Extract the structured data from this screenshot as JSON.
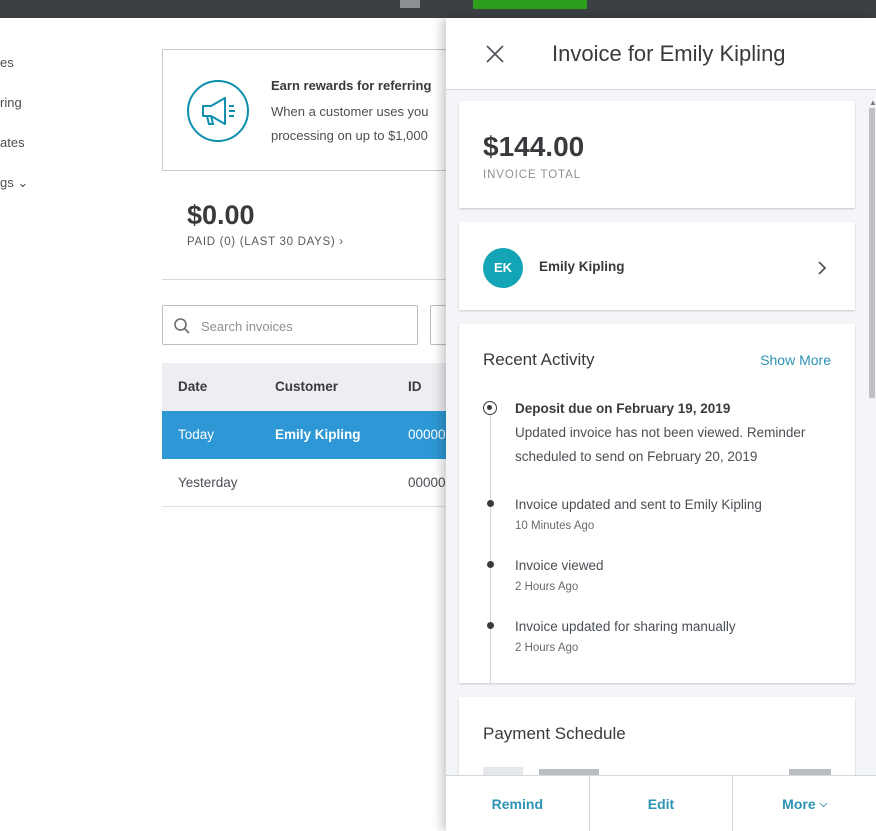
{
  "topbar": {
    "accent": "#2ca01c"
  },
  "left_nav": {
    "items": [
      "es",
      "ring",
      "ates",
      "gs ⌄"
    ]
  },
  "promo": {
    "icon": "megaphone-icon",
    "title": "Earn rewards for referring",
    "line1": "When a customer uses you",
    "line2": "processing on up to $1,000"
  },
  "summary": {
    "amount": "$0.00",
    "label": "PAID (0) (LAST 30 DAYS) ›"
  },
  "search": {
    "placeholder": "Search invoices"
  },
  "table": {
    "columns": [
      "Date",
      "Customer",
      "ID"
    ],
    "rows": [
      {
        "date": "Today",
        "customer": "Emily Kipling",
        "id": "00000",
        "selected": true
      },
      {
        "date": "Yesterday",
        "customer": "",
        "id": "00000",
        "selected": false
      }
    ]
  },
  "panel": {
    "title": "Invoice for Emily Kipling",
    "total": {
      "amount": "$144.00",
      "label": "INVOICE TOTAL"
    },
    "customer": {
      "initials": "EK",
      "name": "Emily Kipling",
      "avatar_color": "#13a5b5"
    },
    "activity": {
      "title": "Recent Activity",
      "show_more": "Show More",
      "items": [
        {
          "text": "Deposit due on February 19, 2019",
          "detail1": "Updated invoice has not been viewed. Reminder",
          "detail2": "scheduled to send on February 20, 2019"
        },
        {
          "text": "Invoice updated and sent to Emily Kipling",
          "time": "10 Minutes Ago"
        },
        {
          "text": "Invoice viewed",
          "time": "2 Hours Ago"
        },
        {
          "text": "Invoice updated for sharing manually",
          "time": "2 Hours Ago"
        }
      ]
    },
    "schedule": {
      "title": "Payment Schedule"
    },
    "footer": {
      "remind": "Remind",
      "edit": "Edit",
      "more": "More"
    },
    "link_color": "#2d93b3"
  }
}
